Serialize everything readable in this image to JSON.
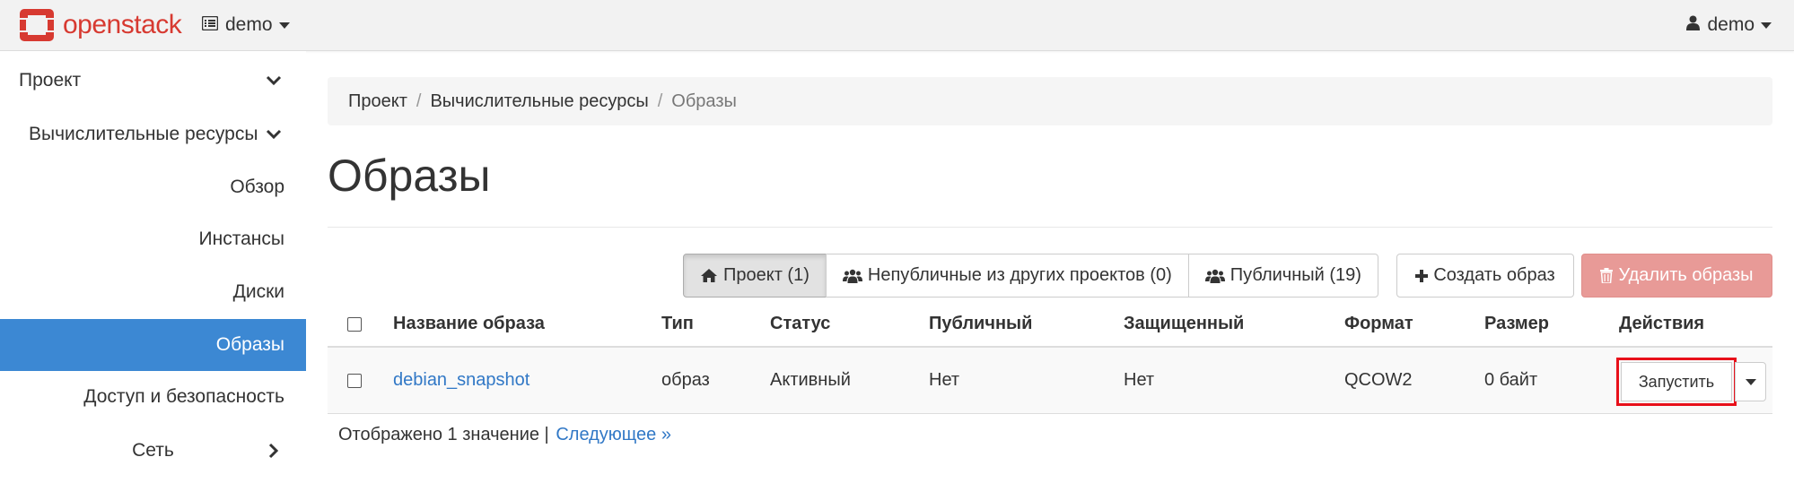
{
  "navbar": {
    "brand": "openstack",
    "project": "demo",
    "user": "demo"
  },
  "sidebar": {
    "project": "Проект",
    "compute": "Вычислительные ресурсы",
    "items": [
      "Обзор",
      "Инстансы",
      "Диски",
      "Образы"
    ],
    "access": "Доступ и безопасность",
    "network": "Сеть"
  },
  "breadcrumb": [
    "Проект",
    "Вычислительные ресурсы",
    "Образы"
  ],
  "page_title": "Образы",
  "filters": [
    {
      "label": "Проект (1)",
      "icon": "home-icon"
    },
    {
      "label": "Непубличные из других проектов (0)",
      "icon": "users-icon"
    },
    {
      "label": "Публичный (19)",
      "icon": "users-icon"
    }
  ],
  "actions": {
    "create": "Создать образ",
    "delete": "Удалить образы"
  },
  "table": {
    "headers": [
      "Название образа",
      "Тип",
      "Статус",
      "Публичный",
      "Защищенный",
      "Формат",
      "Размер",
      "Действия"
    ],
    "rows": [
      {
        "name": "debian_snapshot",
        "type": "образ",
        "status": "Активный",
        "public": "Нет",
        "protected": "Нет",
        "format": "QCOW2",
        "size": "0 байт",
        "action": "Запустить"
      }
    ]
  },
  "footer": {
    "count": "Отображено 1 значение |",
    "next": "Следующее »"
  },
  "colors": {
    "brand": "#d73a31",
    "active_nav": "#3c88d3",
    "link": "#3178c6",
    "danger": "#e89a97",
    "highlight": "#e8101a"
  }
}
